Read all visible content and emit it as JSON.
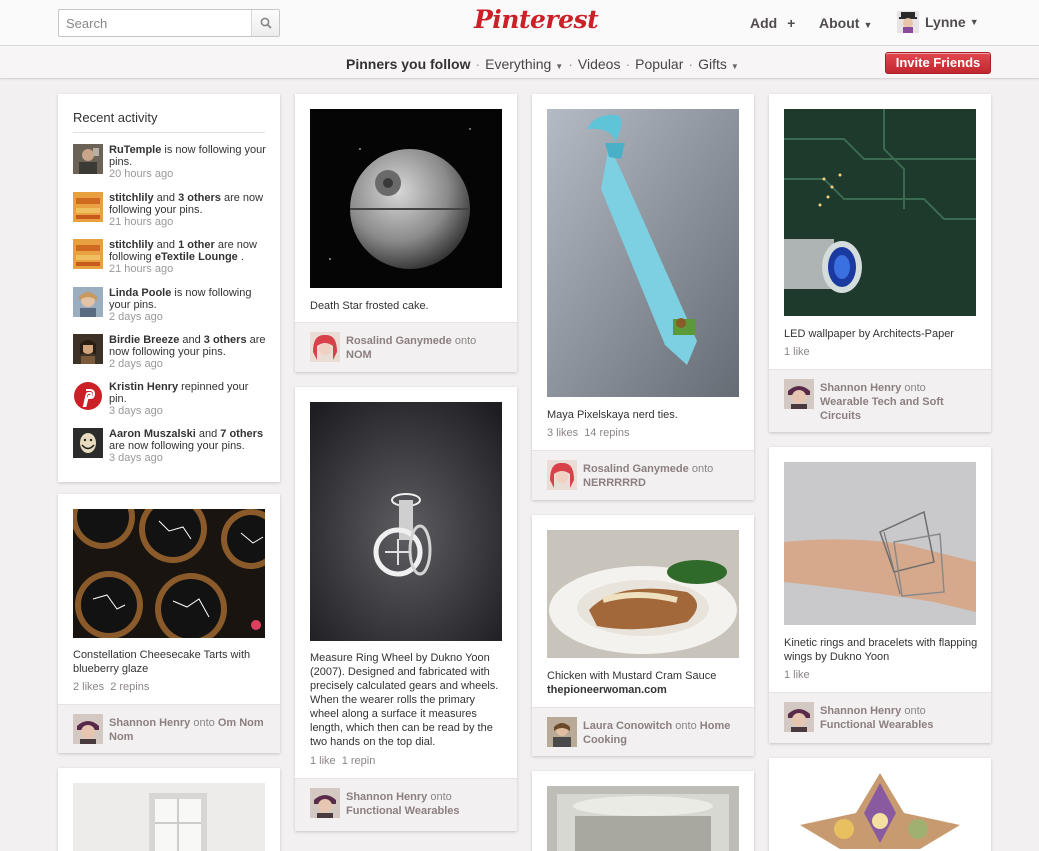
{
  "header": {
    "search_placeholder": "Search",
    "logo": "Pinterest",
    "add_label": "Add",
    "add_icon": "+",
    "about_label": "About",
    "user_name": "Lynne"
  },
  "subnav": {
    "items": [
      {
        "label": "Pinners you follow",
        "active": true
      },
      {
        "label": "Everything",
        "dropdown": true
      },
      {
        "label": "Videos"
      },
      {
        "label": "Popular"
      },
      {
        "label": "Gifts",
        "dropdown": true
      }
    ],
    "separator": "·",
    "invite_label": "Invite Friends"
  },
  "recent_activity": {
    "title": "Recent activity",
    "items": [
      {
        "html_parts": [
          "RuTemple",
          " is now following your pins."
        ],
        "time": "20 hours ago"
      },
      {
        "html_parts": [
          "stitchlily",
          " and ",
          "3 others",
          " are now following your pins."
        ],
        "time": "21 hours ago"
      },
      {
        "html_parts": [
          "stitchlily",
          " and ",
          "1 other",
          " are now following ",
          "eTextile Lounge",
          " ."
        ],
        "time": "21 hours ago"
      },
      {
        "html_parts": [
          "Linda Poole",
          " is now following your pins."
        ],
        "time": "2 days ago"
      },
      {
        "html_parts": [
          "Birdie Breeze",
          " and ",
          "3 others",
          " are now following your pins."
        ],
        "time": "2 days ago"
      },
      {
        "html_parts": [
          "Kristin Henry",
          " repinned your pin."
        ],
        "time": "3 days ago"
      },
      {
        "html_parts": [
          "Aaron Muszalski",
          " and ",
          "7 others",
          " are now following your pins."
        ],
        "time": "3 days ago"
      }
    ]
  },
  "pins": {
    "deathstar": {
      "desc": "Death Star frosted cake.",
      "user": "Rosalind Ganymede",
      "onto": "onto",
      "board": "NOM"
    },
    "measure": {
      "desc": "Measure Ring Wheel by Dukno Yoon (2007). Designed and fabricated with precisely calculated gears and wheels. When the wearer rolls the primary wheel along a surface it measures length, which then can be read by the two hands on the top dial.",
      "likes": "1 like",
      "repins": "1 repin",
      "user": "Shannon Henry",
      "onto": "onto",
      "board": "Functional Wearables"
    },
    "tie": {
      "desc": "Maya Pixelskaya nerd ties.",
      "likes": "3 likes",
      "repins": "14 repins",
      "user": "Rosalind Ganymede",
      "onto": "onto",
      "board": "NERRRRRD"
    },
    "chicken": {
      "desc": "Chicken with Mustard Cram Sauce",
      "source": "thepioneerwoman.com",
      "user": "Laura Conowitch",
      "onto": "onto",
      "board": "Home Cooking"
    },
    "led": {
      "desc": "LED wallpaper by Architects-Paper",
      "likes": "1 like",
      "user": "Shannon Henry",
      "onto": "onto",
      "board": "Wearable Tech and Soft Circuits"
    },
    "kinetic": {
      "desc": "Kinetic rings and bracelets with flapping wings by Dukno Yoon",
      "likes": "1 like",
      "user": "Shannon Henry",
      "onto": "onto",
      "board": "Functional Wearables"
    },
    "tarts": {
      "desc": "Constellation Cheesecake Tarts with blueberry glaze",
      "likes": "2 likes",
      "repins": "2 repins",
      "user": "Shannon Henry",
      "onto": "onto",
      "board": "Om Nom Nom"
    }
  },
  "colors": {
    "brand": "#cb2027",
    "invite": "#d3343c",
    "background": "#f2f0f0"
  },
  "icons": [
    "search-icon",
    "plus-icon",
    "chevron-down-icon",
    "pinterest-p-icon"
  ]
}
